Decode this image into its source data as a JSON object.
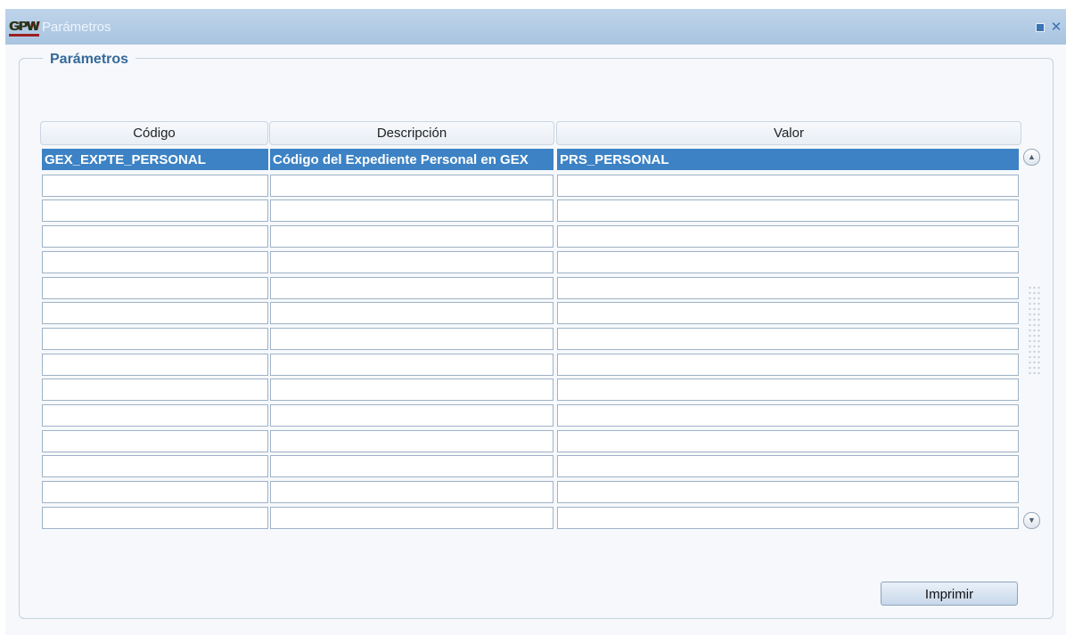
{
  "window": {
    "title": "Parámetros",
    "logo_text": "GPW"
  },
  "section": {
    "legend": "Parámetros"
  },
  "table": {
    "columns": [
      "Código",
      "Descripción",
      "Valor"
    ],
    "rows": [
      [
        "GEX_EXPTE_PERSONAL",
        "Código del Expediente Personal en GEX",
        "PRS_PERSONAL"
      ],
      [
        "",
        "",
        ""
      ],
      [
        "",
        "",
        ""
      ],
      [
        "",
        "",
        ""
      ],
      [
        "",
        "",
        ""
      ],
      [
        "",
        "",
        ""
      ],
      [
        "",
        "",
        ""
      ],
      [
        "",
        "",
        ""
      ],
      [
        "",
        "",
        ""
      ],
      [
        "",
        "",
        ""
      ],
      [
        "",
        "",
        ""
      ],
      [
        "",
        "",
        ""
      ],
      [
        "",
        "",
        ""
      ],
      [
        "",
        "",
        ""
      ],
      [
        "",
        "",
        ""
      ]
    ],
    "selected_row": 0
  },
  "actions": {
    "print_label": "Imprimir"
  },
  "icons": {
    "minimize": "minimize-icon",
    "close": "close-icon",
    "scroll_up": "scroll-up-icon",
    "scroll_down": "scroll-down-icon"
  },
  "colors": {
    "titlebar": "#a9c4e0",
    "selection": "#3c82c4",
    "legend_text": "#356a9a"
  }
}
